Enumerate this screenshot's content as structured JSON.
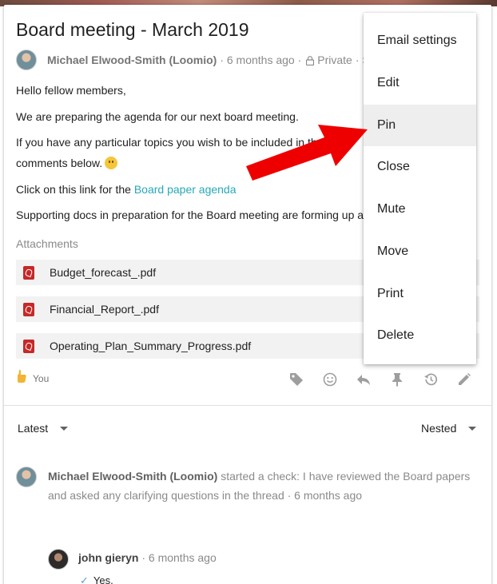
{
  "discussion": {
    "title": "Board meeting - March 2019",
    "author": "Michael Elwood-Smith (Loomio)",
    "meta_time": "· 6 months ago ·",
    "privacy": "Private",
    "seen": "· Seen"
  },
  "body": {
    "line1": "Hello fellow members,",
    "line2": "We are preparing the agenda for our next board meeting.",
    "line3a": "If you have any particular topics you wish to be included in the a",
    "line3b": "e",
    "line4": "comments below.",
    "link_prefix": "Click on this link for the ",
    "link_text": "Board paper agenda",
    "line6": "Supporting docs in preparation for the Board meeting are forming up as a"
  },
  "attachments": {
    "label": "Attachments",
    "files": [
      "Budget_forecast_.pdf",
      "Financial_Report_.pdf",
      "Operating_Plan_Summary_Progress.pdf"
    ]
  },
  "reactions": {
    "icon": "thumbs-up-icon",
    "label": "You"
  },
  "actions": [
    "tag-icon",
    "emoji-icon",
    "reply-icon",
    "pin-icon",
    "history-icon",
    "edit-icon"
  ],
  "sorting": {
    "left": "Latest",
    "right": "Nested"
  },
  "event": {
    "author": "Michael Elwood-Smith (Loomio)",
    "text": "started a check: I have reviewed the Board papers and asked any clarifying questions in the thread · 6 months ago"
  },
  "reply": {
    "author": "john gieryn",
    "time": "· 6 months ago",
    "text": "Yes."
  },
  "menu": {
    "items": [
      "Email settings",
      "Edit",
      "Pin",
      "Close",
      "Mute",
      "Move",
      "Print",
      "Delete"
    ],
    "highlighted": "Pin"
  },
  "colors": {
    "link": "#26a9b8",
    "arrow": "#ee0000",
    "pdf": "#c62828"
  }
}
